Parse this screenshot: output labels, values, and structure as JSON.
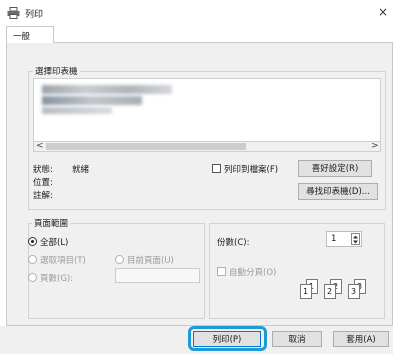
{
  "window": {
    "title": "列印",
    "close_glyph": "×"
  },
  "tabs": [
    {
      "label": "一般"
    }
  ],
  "select_printer": {
    "group_label": "選擇印表機",
    "scroll_left": "<",
    "scroll_right": ">"
  },
  "status": {
    "status_label": "狀態:",
    "status_value": "就緒",
    "location_label": "位置:",
    "comment_label": "註解:"
  },
  "print_to_file": {
    "label": "列印到檔案(F)",
    "checked": false
  },
  "buttons": {
    "preferences": "喜好設定(R)",
    "find_printer": "尋找印表機(D)...",
    "print": "列印(P)",
    "cancel": "取消",
    "apply": "套用(A)"
  },
  "page_range": {
    "group_label": "頁面範圍",
    "all": "全部(L)",
    "selection": "選取項目(T)",
    "current_page": "目前頁面(U)",
    "pages": "頁數(G):",
    "selected": "all"
  },
  "copies": {
    "label": "份數(C):",
    "value": "1",
    "collate_label": "自動分頁(O)",
    "collate_checked": false,
    "collate_pages": [
      "1",
      "1",
      "2",
      "2",
      "3",
      "3"
    ]
  },
  "colors": {
    "highlight": "#1e9ad6",
    "panel_bg": "#f0f0f0"
  }
}
